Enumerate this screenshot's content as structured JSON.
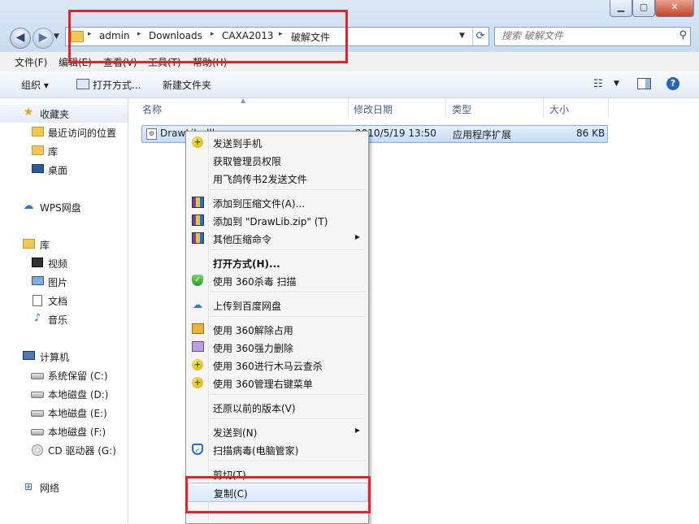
{
  "window": {
    "min": "▁",
    "max": "▢",
    "close": "✕"
  },
  "address": {
    "crumbs": [
      "admin",
      "Downloads",
      "CAXA2013",
      "破解文件"
    ],
    "separator": "▸"
  },
  "search": {
    "placeholder": "搜索 破解文件"
  },
  "menubar": [
    "文件(F)",
    "编辑(E)",
    "查看(V)",
    "工具(T)",
    "帮助(H)"
  ],
  "toolbar": {
    "organize": "组织 ▾",
    "open_with": "打开方式...",
    "new_folder": "新建文件夹"
  },
  "nav": {
    "favorites": "收藏夹",
    "recent": "最近访问的位置",
    "library_fav": "库",
    "desktop": "桌面",
    "wps": "WPS网盘",
    "library": "库",
    "videos": "视频",
    "pictures": "图片",
    "documents": "文档",
    "music": "音乐",
    "computer": "计算机",
    "drive_c": "系统保留 (C:)",
    "drive_d": "本地磁盘 (D:)",
    "drive_e": "本地磁盘 (E:)",
    "drive_f": "本地磁盘 (F:)",
    "drive_g": "CD 驱动器 (G:)",
    "network": "网络"
  },
  "columns": {
    "name": "名称",
    "modified": "修改日期",
    "type": "类型",
    "size": "大小"
  },
  "file": {
    "name": "DrawLib.dll",
    "modified": "2010/5/19 13:50",
    "type": "应用程序扩展",
    "size": "86 KB"
  },
  "context_menu": {
    "send_phone": "发送到手机",
    "admin": "获取管理员权限",
    "feige": "用飞鸽传书2发送文件",
    "add_archive": "添加到压缩文件(A)...",
    "add_zip": "添加到 \"DrawLib.zip\" (T)",
    "other_zip": "其他压缩命令",
    "open_with": "打开方式(H)...",
    "scan360": "使用 360杀毒 扫描",
    "baidu": "上传到百度网盘",
    "unlock360": "使用 360解除占用",
    "delete360": "使用 360强力删除",
    "trojan360": "使用 360进行木马云查杀",
    "rightmenu360": "使用 360管理右键菜单",
    "restore": "还原以前的版本(V)",
    "sendto": "发送到(N)",
    "virus_scan": "扫描病毒(电脑管家)",
    "cut": "剪切(T)",
    "copy": "复制(C)"
  }
}
